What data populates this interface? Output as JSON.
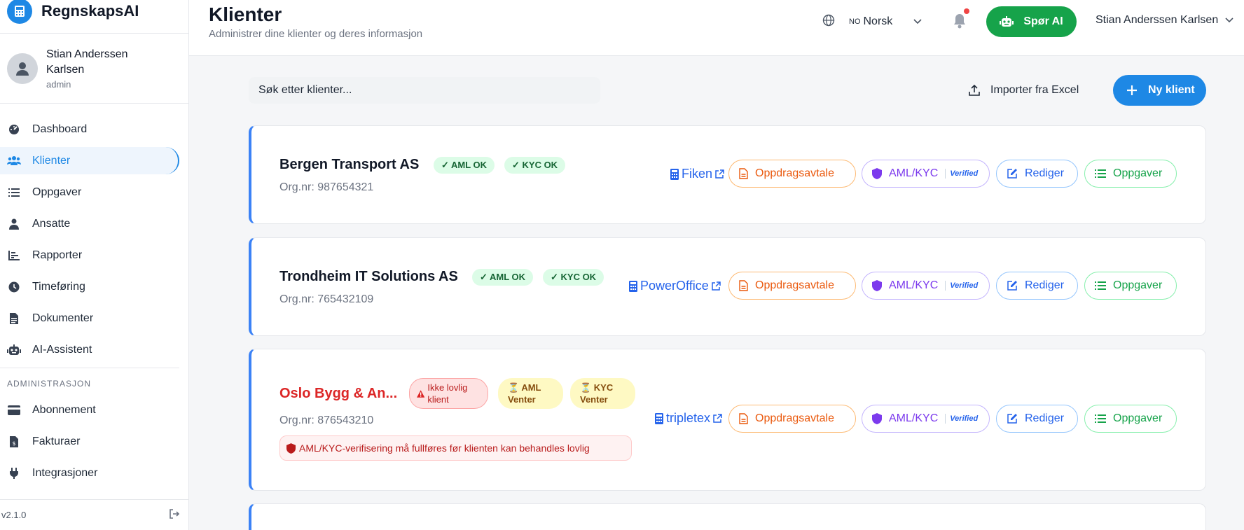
{
  "app": {
    "name": "RegnskapsAI",
    "version": "v2.1.0"
  },
  "user": {
    "name": "Stian Anderssen Karlsen",
    "role": "admin"
  },
  "sidebar": {
    "items": [
      {
        "label": "Dashboard",
        "icon": "dashboard-icon"
      },
      {
        "label": "Klienter",
        "icon": "users-icon",
        "active": true
      },
      {
        "label": "Oppgaver",
        "icon": "task-list-icon"
      },
      {
        "label": "Ansatte",
        "icon": "employee-icon"
      },
      {
        "label": "Rapporter",
        "icon": "chart-icon"
      },
      {
        "label": "Timeføring",
        "icon": "clock-icon"
      },
      {
        "label": "Dokumenter",
        "icon": "document-icon"
      },
      {
        "label": "AI-Assistent",
        "icon": "robot-icon"
      }
    ],
    "admin_section": "ADMINISTRASJON",
    "admin_items": [
      {
        "label": "Abonnement",
        "icon": "credit-card-icon"
      },
      {
        "label": "Fakturaer",
        "icon": "invoice-icon"
      },
      {
        "label": "Integrasjoner",
        "icon": "plug-icon"
      }
    ]
  },
  "header": {
    "title": "Klienter",
    "subtitle": "Administrer dine klienter og deres informasjon",
    "language": {
      "flag": "NO",
      "label": "Norsk"
    },
    "ask_ai": "Spør AI",
    "user_name": "Stian Anderssen Karlsen"
  },
  "toolbar": {
    "search_placeholder": "Søk etter klienter...",
    "import_label": "Importer fra Excel",
    "new_client_label": "Ny klient"
  },
  "actions": {
    "agreement": "Oppdragsavtale",
    "aml": "AML/KYC",
    "verified": "Verified",
    "edit": "Rediger",
    "tasks": "Oppgaver"
  },
  "clients": [
    {
      "name": "Bergen Transport AS",
      "org": "Org.nr: 987654321",
      "badges": [
        "✓ AML OK",
        "✓ KYC OK"
      ],
      "integration": "Fiken"
    },
    {
      "name": "Trondheim IT Solutions AS",
      "org": "Org.nr: 765432109",
      "badges": [
        "✓ AML OK",
        "✓ KYC OK"
      ],
      "integration": "PowerOffice"
    },
    {
      "name": "Oslo Bygg & An...",
      "org": "Org.nr: 876543210",
      "badges": [
        "Ikke lovlig klient",
        "⏳ AML Venter",
        "⏳ KYC Venter"
      ],
      "integration": "tripletex",
      "warning": "AML/KYC-verifisering må fullføres før klienten kan behandles lovlig"
    }
  ],
  "colors": {
    "primary": "#1e88e5",
    "success": "#16a34a",
    "danger": "#dc2626"
  }
}
